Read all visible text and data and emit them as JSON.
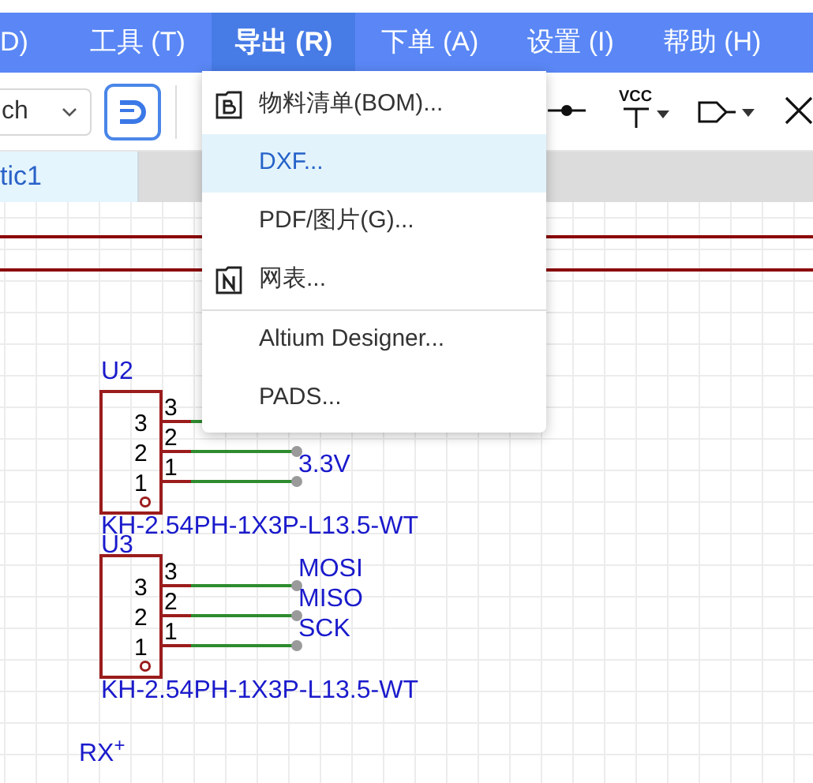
{
  "menubar": [
    {
      "label": "D)",
      "selected": false
    },
    {
      "label": "工具 (T)",
      "selected": false
    },
    {
      "label": "导出 (R)",
      "selected": true
    },
    {
      "label": "下单 (A)",
      "selected": false
    },
    {
      "label": "设置 (I)",
      "selected": false
    },
    {
      "label": "帮助 (H)",
      "selected": false
    }
  ],
  "toolbar": {
    "dropdown_value": "ch",
    "vcc_label": "VCC"
  },
  "tabs": [
    {
      "label": "tic1",
      "selected": true
    }
  ],
  "schematic": {
    "components": [
      {
        "designator": "U2",
        "footprint": "KH-2.54PH-1X3P-L13.5-WT",
        "pins": [
          {
            "number": "3",
            "inner_number": "3"
          },
          {
            "number": "2",
            "inner_number": "2"
          },
          {
            "number": "1",
            "inner_number": "1",
            "net": "3.3V"
          }
        ]
      },
      {
        "designator": "U3",
        "footprint": "KH-2.54PH-1X3P-L13.5-WT",
        "pins": [
          {
            "number": "3",
            "inner_number": "3",
            "net": "MOSI"
          },
          {
            "number": "2",
            "inner_number": "2",
            "net": "MISO"
          },
          {
            "number": "1",
            "inner_number": "1",
            "net": "SCK"
          }
        ]
      }
    ],
    "port_label": "RX$^{+}$"
  },
  "export_menu": [
    {
      "kind": "bom",
      "label": "物料清单(BOM)...",
      "selected": false,
      "separator_after": false
    },
    {
      "kind": "plain",
      "label": "DXF...",
      "selected": true,
      "separator_after": false
    },
    {
      "kind": "plain",
      "label": "PDF/图片(G)...",
      "selected": false,
      "separator_after": false
    },
    {
      "kind": "netlist",
      "label": "网表...",
      "selected": false,
      "separator_after": true
    },
    {
      "kind": "plain",
      "label": "Altium Designer...",
      "selected": false,
      "separator_after": false
    },
    {
      "kind": "plain",
      "label": "PADS...",
      "selected": false,
      "separator_after": false
    }
  ]
}
